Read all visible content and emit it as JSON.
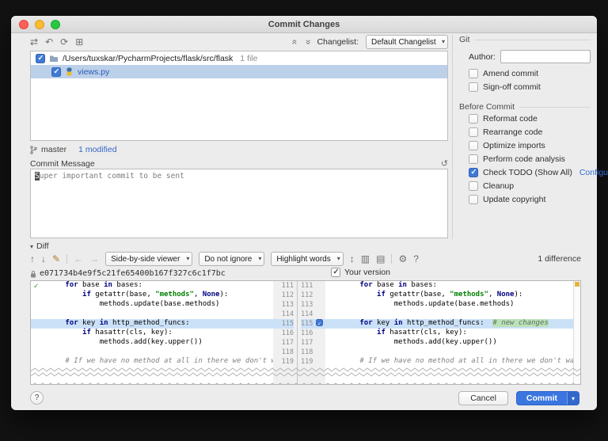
{
  "window": {
    "title": "Commit Changes"
  },
  "toolbar": {
    "changelist_label": "Changelist:",
    "changelist_value": "Default Changelist"
  },
  "tree": {
    "root_path": "/Users/tuxskar/PycharmProjects/flask/src/flask",
    "root_meta": "1 file",
    "root_checked": true,
    "file": "views.py",
    "file_checked": true
  },
  "status": {
    "branch": "master",
    "modified": "1 modified"
  },
  "commit_message": {
    "label": "Commit Message",
    "value": "Super important commit to be sent"
  },
  "git": {
    "section_title": "Git",
    "author_label": "Author:",
    "author_value": "",
    "amend_label": "Amend commit",
    "amend_checked": false,
    "signoff_label": "Sign-off commit",
    "signoff_checked": false,
    "before_title": "Before Commit",
    "options": [
      {
        "label": "Reformat code",
        "checked": false
      },
      {
        "label": "Rearrange code",
        "checked": false
      },
      {
        "label": "Optimize imports",
        "checked": false
      },
      {
        "label": "Perform code analysis",
        "checked": false
      },
      {
        "label": "Check TODO (Show All)",
        "checked": true,
        "link": "Configure"
      },
      {
        "label": "Cleanup",
        "checked": false
      },
      {
        "label": "Update copyright",
        "checked": false
      }
    ]
  },
  "diff": {
    "section_title": "Diff",
    "viewer_mode": "Side-by-side viewer",
    "ignore_mode": "Do not ignore",
    "highlight_mode": "Highlight words",
    "difference_count": "1 difference",
    "revision_hash": "e071734b4e9f5c21fe65400b167f327c6c1f7bc",
    "right_title": "Your version",
    "your_version_checked": true,
    "rows": [
      {
        "l": "111",
        "r": "111",
        "left": [
          [
            "        ",
            "p"
          ],
          [
            "for",
            "k"
          ],
          [
            " base ",
            "p"
          ],
          [
            "in",
            "k"
          ],
          [
            " bases:",
            "p"
          ]
        ]
      },
      {
        "l": "112",
        "r": "112",
        "left": [
          [
            "            ",
            "p"
          ],
          [
            "if",
            "k"
          ],
          [
            " getattr(base, ",
            "p"
          ],
          [
            "\"methods\"",
            "s"
          ],
          [
            ", ",
            "p"
          ],
          [
            "None",
            "k"
          ],
          [
            "):",
            "p"
          ]
        ]
      },
      {
        "l": "113",
        "r": "113",
        "left": [
          [
            "                methods.update(base.methods)",
            "p"
          ]
        ]
      },
      {
        "l": "114",
        "r": "114",
        "left": []
      },
      {
        "l": "115",
        "r": "115",
        "hl": true,
        "cb": true,
        "left": [
          [
            "        ",
            "p"
          ],
          [
            "for",
            "k"
          ],
          [
            " key ",
            "p"
          ],
          [
            "in",
            "k"
          ],
          [
            " http_method_funcs:",
            "p"
          ]
        ],
        "right": [
          [
            "        ",
            "p"
          ],
          [
            "for",
            "k"
          ],
          [
            " key ",
            "p"
          ],
          [
            "in",
            "k"
          ],
          [
            " http_method_funcs:",
            "p"
          ],
          [
            "  ",
            "p"
          ],
          [
            "# new changes",
            "n"
          ]
        ]
      },
      {
        "l": "116",
        "r": "116",
        "left": [
          [
            "            ",
            "p"
          ],
          [
            "if",
            "k"
          ],
          [
            " hasattr(cls, key):",
            "p"
          ]
        ]
      },
      {
        "l": "117",
        "r": "117",
        "left": [
          [
            "                methods.add(key.upper())",
            "p"
          ]
        ]
      },
      {
        "l": "118",
        "r": "118",
        "left": []
      },
      {
        "l": "119",
        "r": "119",
        "left": [
          [
            "        ",
            "p"
          ],
          [
            "# If we have no method at all in there we don't want",
            "c"
          ]
        ]
      }
    ]
  },
  "footer": {
    "cancel": "Cancel",
    "commit": "Commit"
  },
  "icons": {
    "dropdown_arrow": "▾",
    "show_diff": "⇄",
    "rollback": "↶",
    "refresh": "⟳",
    "group_by": "⊞",
    "chevrons": "«",
    "prev_diff": "↑",
    "next_diff": "↓",
    "edit": "✎",
    "back": "←",
    "forward": "→",
    "collapse_unchanged": "↕",
    "columns": "▥",
    "annotate": "▤",
    "settings": "⚙",
    "help": "?",
    "history": "↺"
  },
  "colors": {
    "accent_blue": "#3b76e0",
    "selection_blue": "#bcd0ea",
    "line_highlight": "#cbe1f8",
    "added_highlight": "#b9e2b9",
    "change_marker": "#e2b63c",
    "modified_file_text": "#2b5ab5"
  }
}
